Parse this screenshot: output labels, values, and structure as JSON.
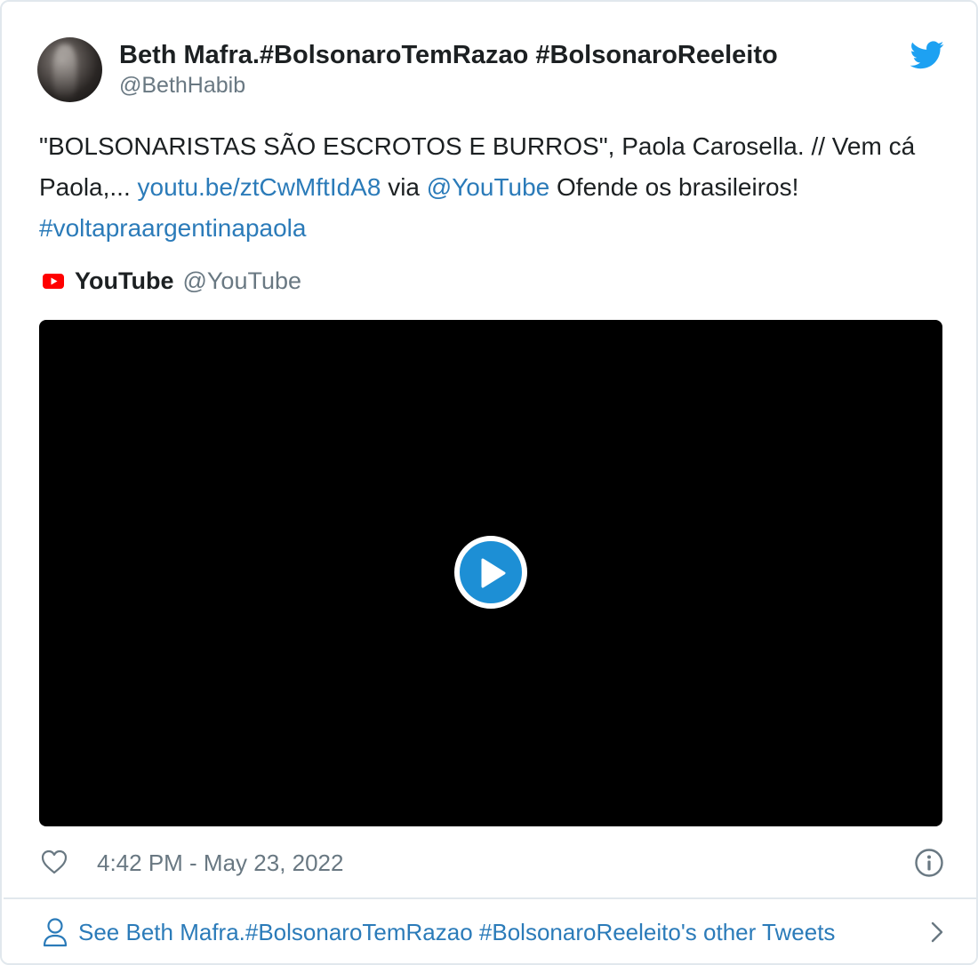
{
  "author": {
    "name": "Beth Mafra.#BolsonaroTemRazao #BolsonaroReeleito",
    "handle": "@BethHabib"
  },
  "tweet": {
    "text_1": "\"BOLSONARISTAS SÃO ESCROTOS E BURROS\", Paola Carosella. // Vem cá Paola,... ",
    "link_1": "youtu.be/ztCwMftIdA8",
    "text_2": " via ",
    "mention": "@YouTube",
    "text_3": " Ofende os brasileiros! ",
    "hashtag": "#voltapraargentinapaola"
  },
  "source": {
    "name": "YouTube",
    "handle": "@YouTube",
    "icon": "youtube-icon"
  },
  "media": {
    "play_icon": "play-icon"
  },
  "meta": {
    "timestamp": "4:42 PM - May 23, 2022",
    "like_icon": "heart-icon",
    "info_icon": "info-icon"
  },
  "footer": {
    "label": "See Beth Mafra.#BolsonaroTemRazao #BolsonaroReeleito's other Tweets",
    "icon": "person-icon"
  },
  "colors": {
    "link": "#2b7bb9",
    "twitter_blue": "#1da1f2",
    "muted": "#697882",
    "text": "#1c2022",
    "youtube_red": "#ff0000",
    "play_button": "#1d8fd5"
  }
}
